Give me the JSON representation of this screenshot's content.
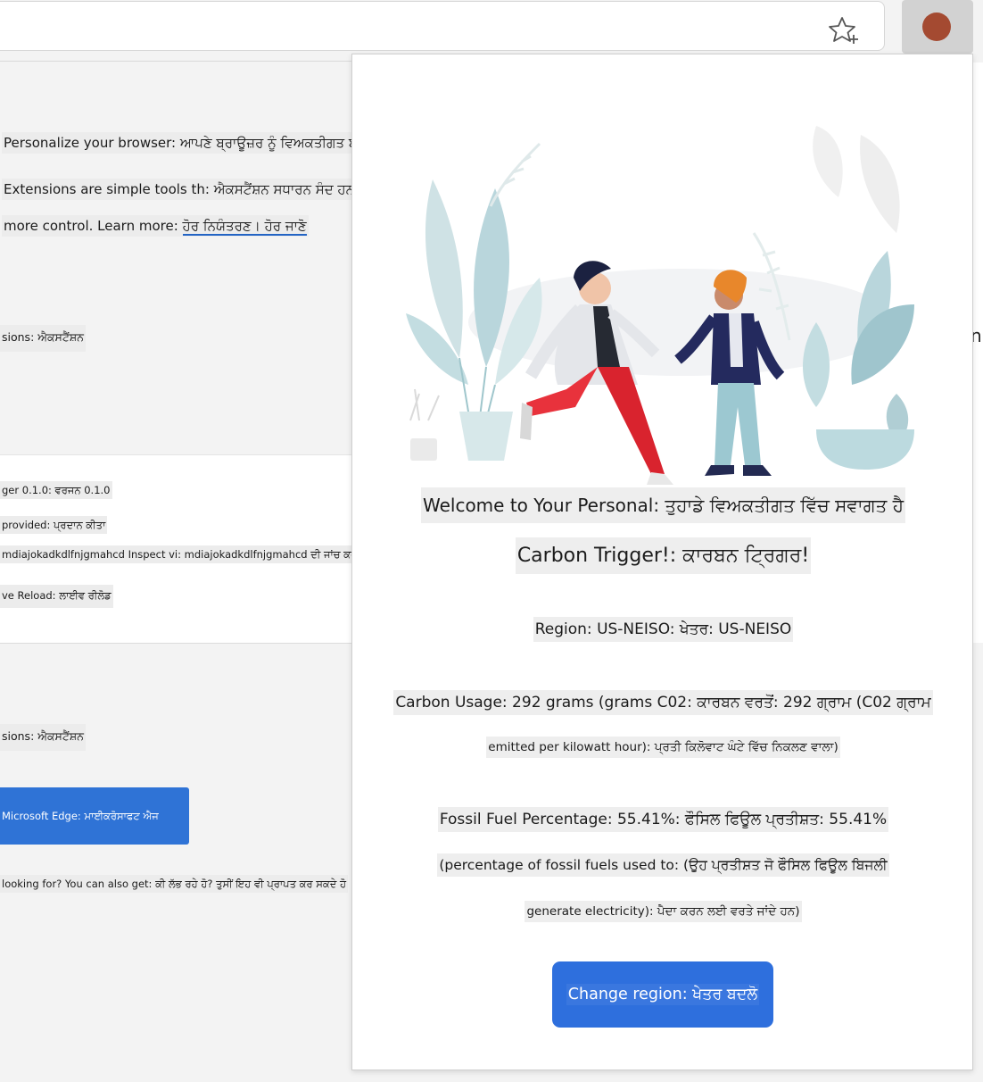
{
  "background_page": {
    "personalize": "Personalize your browser: ਆਪਣੇ ਬ੍ਰਾਊਜ਼ਰ ਨੂੰ ਵਿਅਕਤੀਗਤ ਬਣਾਓ",
    "extensions_line1": "Extensions are simple tools th: ਐਕਸਟੈਂਸ਼ਨ ਸਧਾਰਨ ਸੰਦ ਹਨ",
    "extensions_line2_prefix": "more control. Learn more: ",
    "learn_more_link": "ਹੋਰ ਨਿਯੰਤਰਣ। ਹੋਰ ਜਾਣੋ",
    "section1_heading": "sions: ਐਕਸਟੈਂਸ਼ਨ",
    "ext_card": {
      "version": "ger 0.1.0: ਵਰਜਨ 0.1.0",
      "provided": "provided: ਪ੍ਰਦਾਨ ਕੀਤਾ",
      "inspect": "mdiajokadkdlfnjgmahcd Inspect vi: mdiajokadkdlfnjgmahcd ਦੀ ਜਾਂਚ ਕਰੋ",
      "reload": "ve Reload: ਲਾਈਵ ਰੀਲੋਡ"
    },
    "section2_heading": "sions: ਐਕਸਟੈਂਸ਼ਨ",
    "edge_button": "Microsoft Edge: ਮਾਈਕਰੋਸਾਫਟ ਐਜ",
    "looking_for": "looking for? You can also get: ਕੀ ਲੱਭ ਰਹੇ ਹੋ? ਤੁਸੀਂ ਇਹ ਵੀ ਪ੍ਰਾਪਤ ਕਰ ਸਕਦੇ ਹੋ",
    "edge_letter": "n"
  },
  "toolbar": {
    "favorite_icon": "star-add-icon",
    "extension_color": "#a44a31"
  },
  "popup": {
    "welcome": "Welcome to Your Personal: ਤੁਹਾਡੇ ਵਿਅਕਤੀਗਤ ਵਿੱਚ ਸਵਾਗਤ ਹੈ",
    "title": "Carbon Trigger!: ਕਾਰਬਨ ਟ੍ਰਿਗਰ!",
    "region": "Region: US-NEISO: ਖੇਤਰ: US-NEISO",
    "usage_line1": "Carbon Usage: 292 grams (grams C02: ਕਾਰਬਨ ਵਰਤੋਂ: 292 ਗ੍ਰਾਮ (C02 ਗ੍ਰਾਮ",
    "usage_line2": "emitted per kilowatt hour): ਪ੍ਰਤੀ ਕਿਲੋਵਾਟ ਘੰਟੇ ਵਿੱਚ ਨਿਕਲਣ ਵਾਲਾ)",
    "fossil_line1": "Fossil Fuel Percentage: 55.41%: ਫੌਸਿਲ ਫਿਊਲ ਪ੍ਰਤੀਸ਼ਤ: 55.41%",
    "fossil_line2": "(percentage of fossil fuels used to: (ਉਹ ਪ੍ਰਤੀਸ਼ਤ ਜੋ ਫੌਸਿਲ ਫਿਊਲ ਬਿਜਲੀ",
    "fossil_line3": "generate electricity): ਪੈਦਾ ਕਰਨ ਲਈ ਵਰਤੇ ਜਾਂਦੇ ਹਨ)",
    "change_region_button": "Change region: ਖੇਤਰ ਬਦਲੋ",
    "accent_color": "#2e6fdd"
  }
}
